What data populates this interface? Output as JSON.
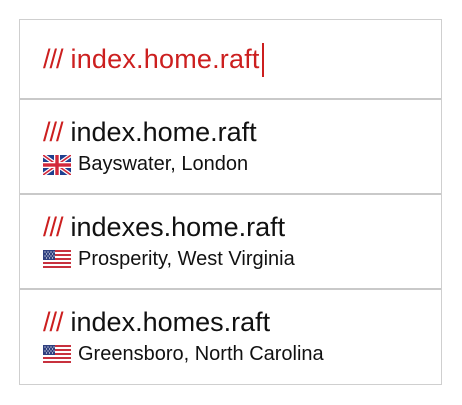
{
  "search": {
    "slashes": "///",
    "value": "index.home.raft"
  },
  "results": [
    {
      "slashes": "///",
      "words": "index.home.raft",
      "location": "Bayswater, London",
      "flag_icon": "uk-flag-icon"
    },
    {
      "slashes": "///",
      "words": "indexes.home.raft",
      "location": "Prosperity, West Virginia",
      "flag_icon": "us-flag-icon"
    },
    {
      "slashes": "///",
      "words": "index.homes.raft",
      "location": "Greensboro, North Carolina",
      "flag_icon": "us-flag-icon"
    }
  ],
  "colors": {
    "accent_red": "#cc1f1f",
    "text": "#111111",
    "divider": "#c9c9c9"
  }
}
